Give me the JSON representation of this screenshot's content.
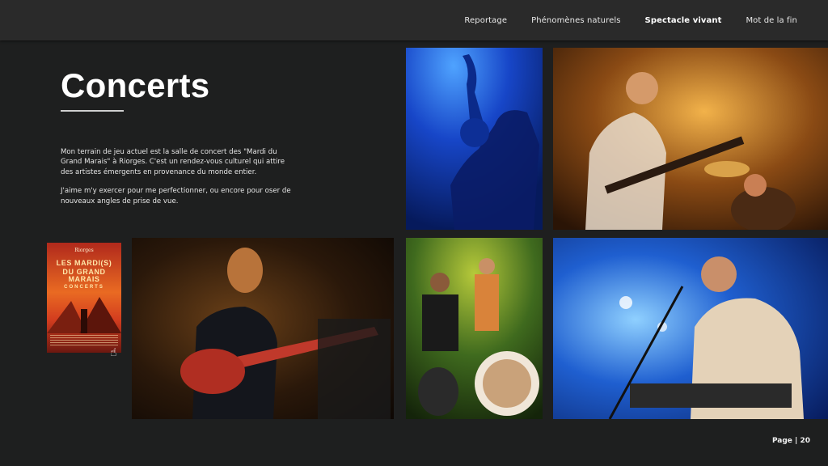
{
  "nav": {
    "items": [
      "Reportage",
      "Phénomènes naturels",
      "Spectacle vivant",
      "Mot de la fin"
    ],
    "active": "Spectacle vivant"
  },
  "page": {
    "title": "Concerts",
    "paragraphs": [
      "Mon terrain de jeu actuel est la salle de concert des \"Mardi du Grand Marais\" à Riorges. C'est un rendez-vous culturel qui attire des artistes émergents en provenance du monde entier.",
      "J'aime m'y exercer pour me perfectionner, ou encore pour oser de nouveaux angles de prise de vue."
    ]
  },
  "poster": {
    "logo": "Riorges",
    "lines": [
      "LES MARDI(S)",
      "DU GRAND",
      "MARAIS"
    ],
    "subtitle": "CONCERTS"
  },
  "footer": {
    "page_label": "Page | 20"
  },
  "colors": {
    "background": "#1e1f1f",
    "topbar": "#2a2a2a"
  }
}
